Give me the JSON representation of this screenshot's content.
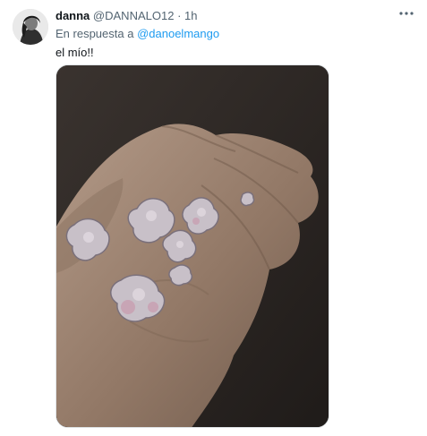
{
  "tweet": {
    "author_name": "danna",
    "author_handle": "@DANNALO12",
    "separator": "·",
    "timestamp": "1h",
    "reply_prefix": "En respuesta a",
    "reply_to": "@danoelmango",
    "text": "el mío!!"
  },
  "icons": {
    "more": "more-horizontal-icon"
  },
  "colors": {
    "link": "#1d9bf0",
    "secondary_text": "#536471",
    "primary_text": "#0f1419"
  }
}
